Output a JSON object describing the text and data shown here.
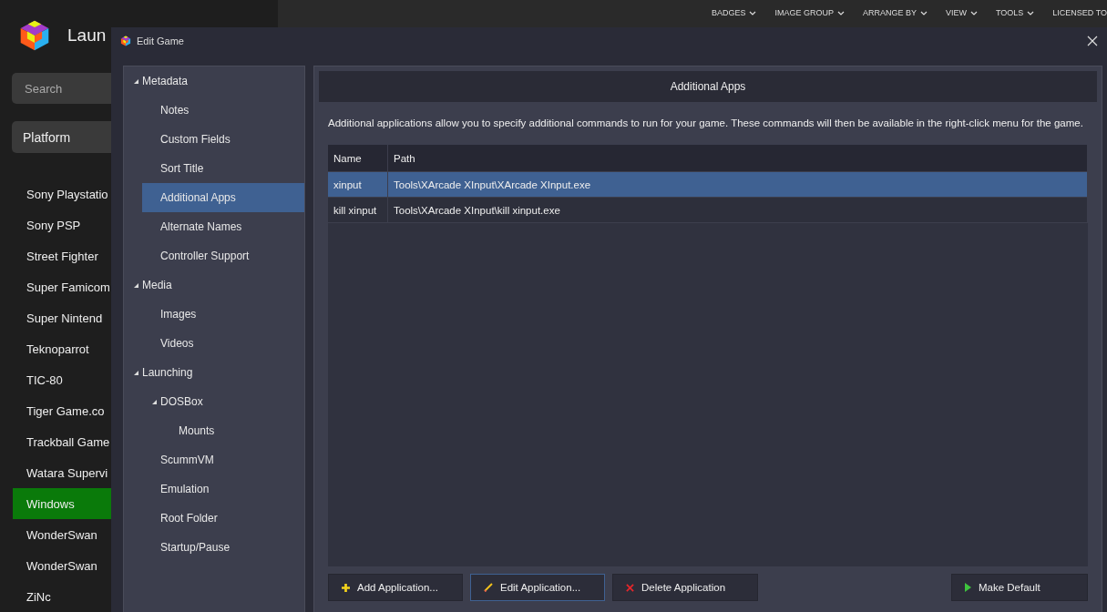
{
  "app": {
    "title": "Laun",
    "search": {
      "placeholder": "Search"
    },
    "filter": "Platform",
    "menu": [
      "BADGES",
      "IMAGE GROUP",
      "ARRANGE BY",
      "VIEW",
      "TOOLS",
      "LICENSED TO"
    ],
    "platforms": [
      {
        "label": "Sony Playstatio",
        "selected": false
      },
      {
        "label": "Sony PSP",
        "selected": false
      },
      {
        "label": "Street Fighter",
        "selected": false
      },
      {
        "label": "Super Famicom",
        "selected": false
      },
      {
        "label": "Super Nintend",
        "selected": false
      },
      {
        "label": "Teknoparrot",
        "selected": false
      },
      {
        "label": "TIC-80",
        "selected": false
      },
      {
        "label": "Tiger Game.co",
        "selected": false
      },
      {
        "label": "Trackball Game",
        "selected": false
      },
      {
        "label": "Watara Supervi",
        "selected": false
      },
      {
        "label": "Windows",
        "selected": true
      },
      {
        "label": "WonderSwan",
        "selected": false
      },
      {
        "label": "WonderSwan",
        "selected": false
      },
      {
        "label": "ZiNc",
        "selected": false
      }
    ]
  },
  "dialog": {
    "title": "Edit Game",
    "tree": [
      {
        "label": "Metadata",
        "expanded": true,
        "selected": false,
        "children": [
          {
            "label": "Notes",
            "selected": false
          },
          {
            "label": "Custom Fields",
            "selected": false
          },
          {
            "label": "Sort Title",
            "selected": false
          },
          {
            "label": "Additional Apps",
            "selected": true
          },
          {
            "label": "Alternate Names",
            "selected": false
          },
          {
            "label": "Controller Support",
            "selected": false
          }
        ]
      },
      {
        "label": "Media",
        "expanded": true,
        "selected": false,
        "children": [
          {
            "label": "Images",
            "selected": false
          },
          {
            "label": "Videos",
            "selected": false
          }
        ]
      },
      {
        "label": "Launching",
        "expanded": true,
        "selected": false,
        "children": [
          {
            "label": "DOSBox",
            "expanded": true,
            "selected": false,
            "children": [
              {
                "label": "Mounts",
                "selected": false
              }
            ]
          },
          {
            "label": "ScummVM",
            "selected": false
          },
          {
            "label": "Emulation",
            "selected": false
          },
          {
            "label": "Root Folder",
            "selected": false
          },
          {
            "label": "Startup/Pause",
            "selected": false
          }
        ]
      }
    ],
    "section_title": "Additional Apps",
    "description": "Additional applications allow you to specify additional commands to run for your game.  These commands will then be available in the right-click menu for the game.",
    "table": {
      "columns": [
        "Name",
        "Path"
      ],
      "rows": [
        {
          "cells": [
            "xinput",
            "Tools\\XArcade XInput\\XArcade XInput.exe"
          ],
          "selected": true
        },
        {
          "cells": [
            "kill xinput",
            "Tools\\XArcade XInput\\kill xinput.exe"
          ],
          "selected": false
        }
      ]
    },
    "buttons": [
      {
        "label": "Add Application...",
        "kind": "add",
        "focused": false
      },
      {
        "label": "Edit Application...",
        "kind": "edit",
        "focused": true
      },
      {
        "label": "Delete Application",
        "kind": "delete",
        "focused": false
      },
      {
        "label": "Make Default",
        "kind": "default",
        "focused": false
      }
    ]
  }
}
